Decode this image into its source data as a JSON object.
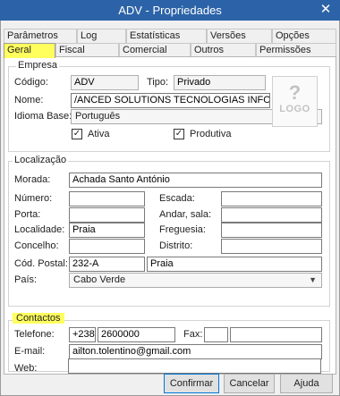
{
  "window": {
    "title": "ADV - Propriedades",
    "close_glyph": "✕"
  },
  "tabs": {
    "row1": [
      "Parâmetros",
      "Log",
      "Estatísticas",
      "Versões",
      "Opções"
    ],
    "row2": [
      "Geral",
      "Fiscal",
      "Comercial",
      "Outros",
      "Permissões"
    ],
    "active": "Geral"
  },
  "empresa": {
    "legend": "Empresa",
    "codigo_label": "Código:",
    "codigo_value": "ADV",
    "tipo_label": "Tipo:",
    "tipo_value": "Privado",
    "nome_label": "Nome:",
    "nome_value": "/ANCED SOLUTIONS TECNOLOGIAS INFORMAÇÃO ,LDA",
    "idioma_label": "Idioma Base:",
    "idioma_value": "Português",
    "ativa_label": "Ativa",
    "ativa_checked": true,
    "produtiva_label": "Produtiva",
    "produtiva_checked": true,
    "logo_mark": "?",
    "logo_text": "LOGO"
  },
  "localizacao": {
    "legend": "Localização",
    "morada_label": "Morada:",
    "morada_value": "Achada Santo António",
    "numero_label": "Número:",
    "numero_value": "",
    "escada_label": "Escada:",
    "escada_value": "",
    "porta_label": "Porta:",
    "porta_value": "",
    "andar_label": "Andar, sala:",
    "andar_value": "",
    "localidade_label": "Localidade:",
    "localidade_value": "Praia",
    "freguesia_label": "Freguesia:",
    "freguesia_value": "",
    "concelho_label": "Concelho:",
    "concelho_value": "",
    "distrito_label": "Distrito:",
    "distrito_value": "",
    "cod_postal_label": "Cód. Postal:",
    "cod_postal_value": "232-A",
    "cod_postal_local": "Praia",
    "pais_label": "País:",
    "pais_value": "Cabo Verde"
  },
  "contactos": {
    "legend": "Contactos",
    "telefone_label": "Telefone:",
    "telefone_prefix": "+238",
    "telefone_value": "2600000",
    "fax_label": "Fax:",
    "fax_prefix": "",
    "fax_value": "",
    "email_label": "E-mail:",
    "email_value": "ailton.tolentino@gmail.com",
    "web_label": "Web:",
    "web_value": ""
  },
  "buttons": {
    "confirmar": "Confirmar",
    "cancelar": "Cancelar",
    "ajuda": "Ajuda"
  },
  "colors": {
    "titlebar": "#2c63a8",
    "highlight": "#ffff5e",
    "default_button_border": "#0078d7"
  }
}
